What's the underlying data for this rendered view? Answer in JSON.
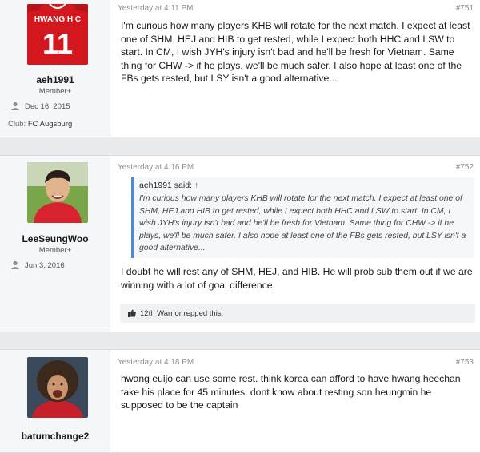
{
  "posts": [
    {
      "username": "aeh1991",
      "usertitle": "Member+",
      "joined": "Dec 16, 2015",
      "club_label": "Club:",
      "club_value": "FC Augsburg",
      "avatar_name": "HWANG H C",
      "avatar_number": "11",
      "date": "Yesterday at 4:11 PM",
      "number": "#751",
      "body": "I'm curious how many players KHB will rotate for the next match. I expect at least one of SHM, HEJ and HIB to get rested, while I expect both HHC and LSW to start. In CM, I wish JYH's injury isn't bad and he'll be fresh for Vietnam. Same thing for CHW -> if he plays, we'll be much safer. I also hope at least one of the FBs gets rested, but LSY isn't a good alternative..."
    },
    {
      "username": "LeeSeungWoo",
      "usertitle": "Member+",
      "joined": "Jun 3, 2016",
      "date": "Yesterday at 4:16 PM",
      "number": "#752",
      "quote_author": "aeh1991 said:",
      "quote_arrow": "↑",
      "quote_text": "I'm curious how many players KHB will rotate for the next match. I expect at least one of SHM, HEJ and HIB to get rested, while I expect both HHC and LSW to start. In CM, I wish JYH's injury isn't bad and he'll be fresh for Vietnam. Same thing for CHW -> if he plays, we'll be much safer. I also hope at least one of the FBs gets rested, but LSY isn't a good alternative...",
      "body": "I doubt he will rest any of SHM, HEJ, and HIB. He will prob sub them out if we are winning with a lot of goal difference.",
      "likes": "12th Warrior repped this."
    },
    {
      "username": "batumchange2",
      "date": "Yesterday at 4:18 PM",
      "number": "#753",
      "body": "hwang euijo can use some rest. think korea can afford to have hwang heechan take his place for 45 minutes. dont know about resting son heungmin he supposed to be the captain"
    }
  ],
  "colors": {
    "accent": "#4a8be0",
    "meta": "#8a8f96",
    "sidebar": "#f5f6f7",
    "page": "#e9eaec"
  }
}
